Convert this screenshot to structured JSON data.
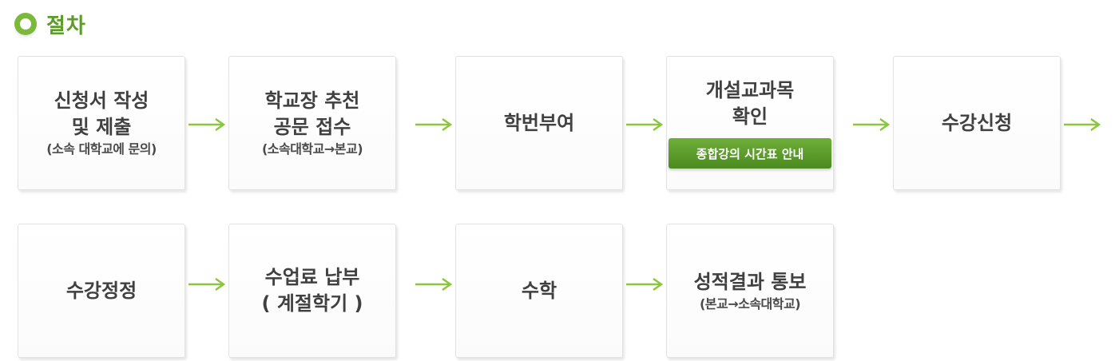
{
  "section": {
    "title": "절차"
  },
  "steps": [
    {
      "lines": [
        "신청서 작성",
        "및 제출"
      ],
      "sub": "(소속 대학교에 문의)"
    },
    {
      "lines": [
        "학교장 추천",
        "공문 접수"
      ],
      "sub": "(소속대학교→본교)"
    },
    {
      "lines": [
        "학번부여"
      ]
    },
    {
      "lines": [
        "개설교과목",
        "확인"
      ],
      "button": "종합강의 시간표 안내"
    },
    {
      "lines": [
        "수강신청"
      ]
    },
    {
      "lines": [
        "수강정정"
      ]
    },
    {
      "lines": [
        "수업료 납부",
        "( 계절학기 )"
      ]
    },
    {
      "lines": [
        "수학"
      ]
    },
    {
      "lines": [
        "성적결과 통보"
      ],
      "sub": "(본교→소속대학교)"
    }
  ],
  "colors": {
    "accent": "#7cb83a",
    "title": "#5d9c2a",
    "button": "#5a9a2a"
  },
  "icons": {
    "bullet": "ring-bullet-icon",
    "flow": "arrow-right-icon"
  }
}
